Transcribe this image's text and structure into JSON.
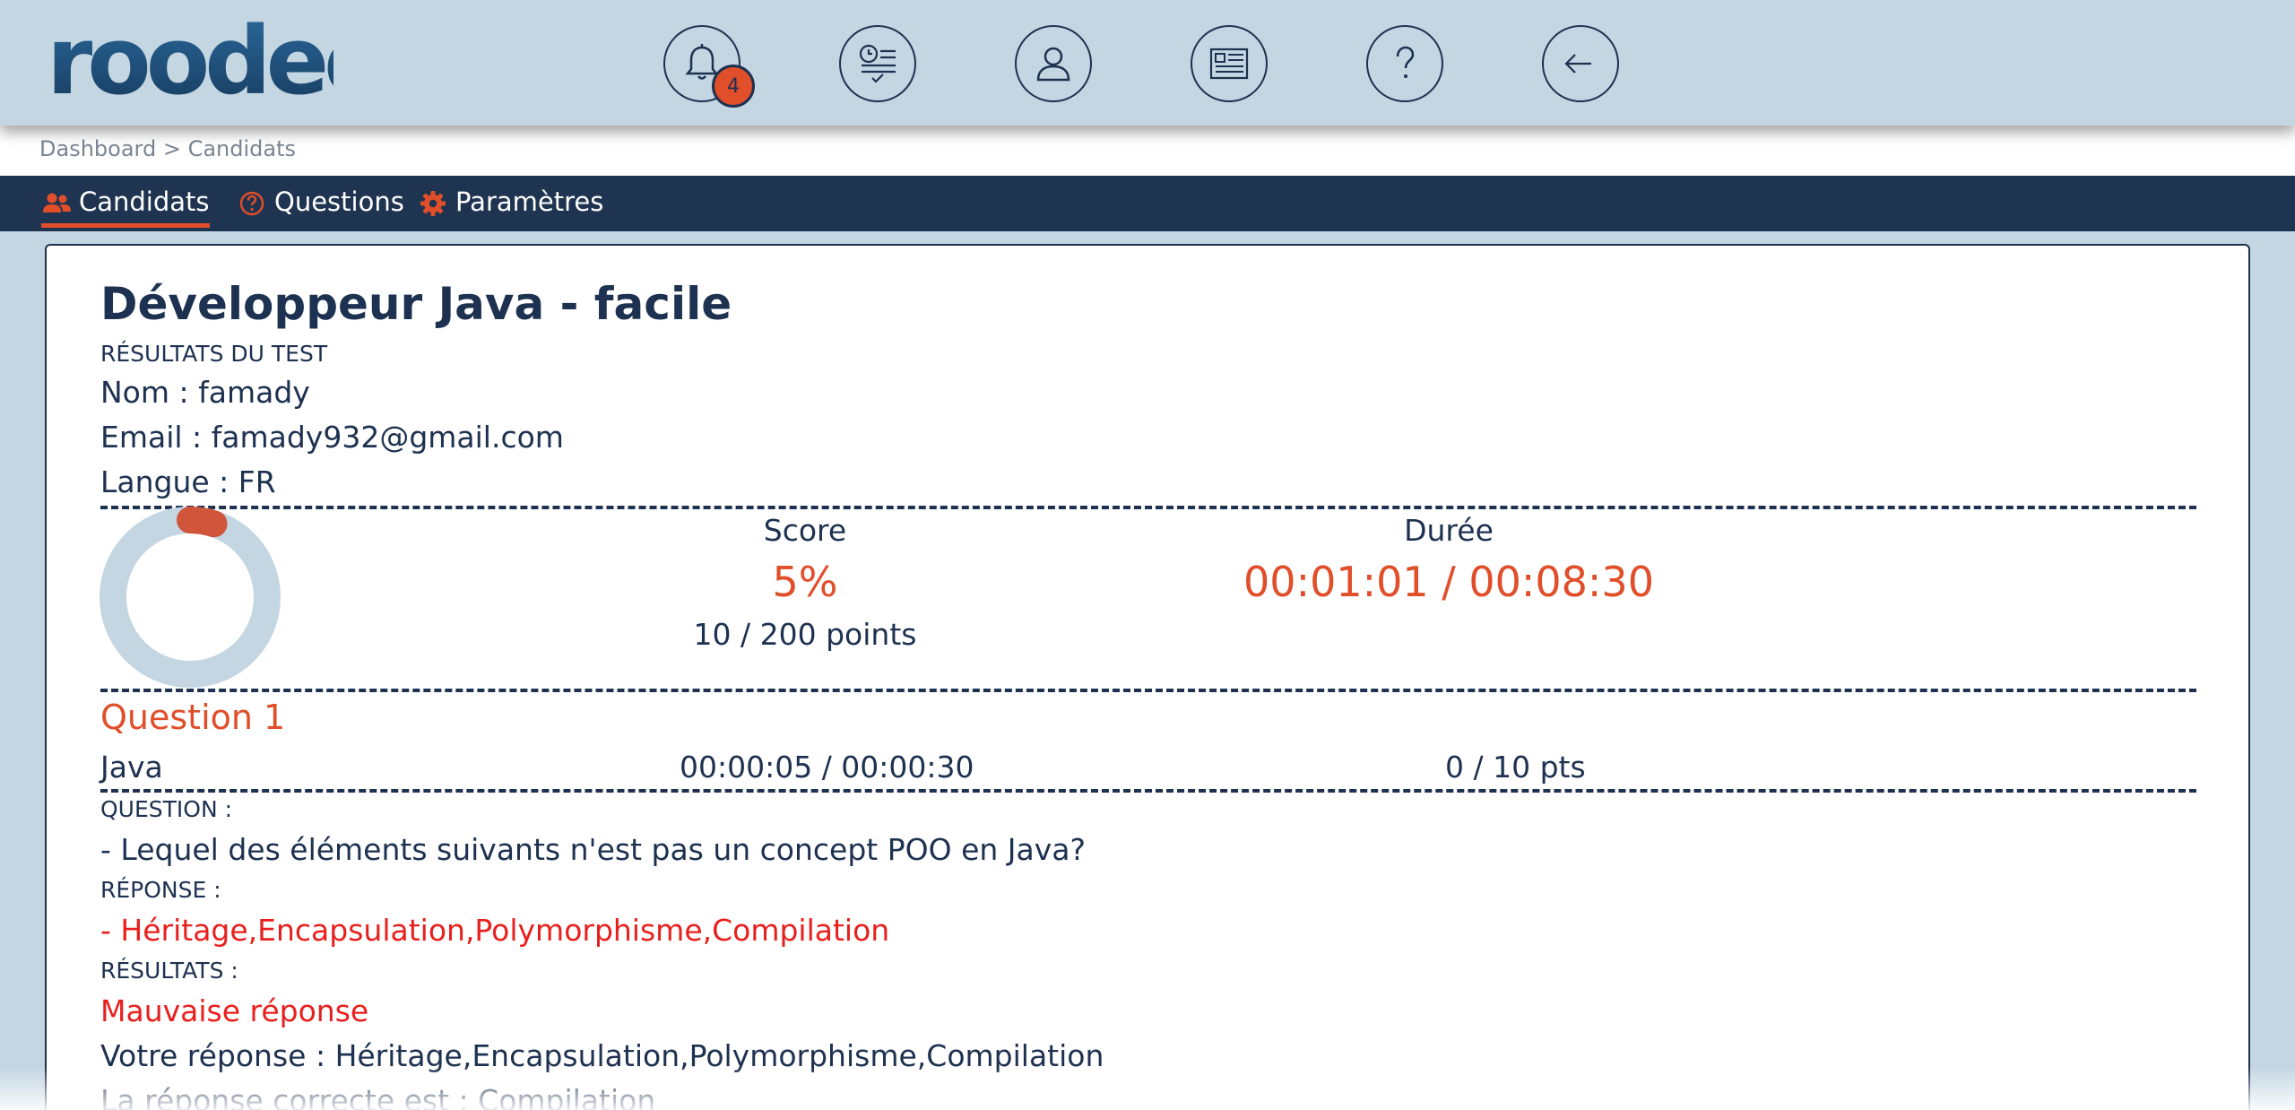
{
  "app": {
    "logo_text": "roodeo",
    "brand_color": "#1f4e78",
    "accent_color": "#e04e2a"
  },
  "header": {
    "icons": [
      {
        "name": "bell-icon",
        "badge": "4"
      },
      {
        "name": "test-history-icon"
      },
      {
        "name": "user-icon"
      },
      {
        "name": "document-list-icon"
      },
      {
        "name": "help-icon"
      },
      {
        "name": "back-arrow-icon"
      }
    ]
  },
  "breadcrumb": "Dashboard > Candidats",
  "tabs": [
    {
      "label": "Candidats",
      "icon": "users-icon",
      "active": true
    },
    {
      "label": "Questions",
      "icon": "question-circle-icon",
      "active": false
    },
    {
      "label": "Paramètres",
      "icon": "gear-icon",
      "active": false
    }
  ],
  "result": {
    "title": "Développeur Java - facile",
    "subtitle": "RÉSULTATS DU TEST",
    "nom": "Nom : famady",
    "email": "Email : famady932@gmail.com",
    "langue": "Langue : FR",
    "score_label": "Score",
    "score_value": "5%",
    "score_fraction": 0.05,
    "score_points": "10 / 200 points",
    "duree_label": "Durée",
    "duree_value": "00:01:01 / 00:08:30"
  },
  "question": {
    "title": "Question 1",
    "topic": "Java",
    "time": "00:00:05 / 00:00:30",
    "points": "0 / 10 pts",
    "question_label": "QUESTION :",
    "question_text": "- Lequel des éléments suivants n'est pas un concept POO en Java?",
    "reponse_label": "RÉPONSE :",
    "reponse_text": "- Héritage,Encapsulation,Polymorphisme,Compilation",
    "resultats_label": "RÉSULTATS :",
    "verdict": "Mauvaise réponse",
    "votre_reponse": "Votre réponse : Héritage,Encapsulation,Polymorphisme,Compilation",
    "reponse_correcte": "La réponse correcte est : Compilation"
  }
}
